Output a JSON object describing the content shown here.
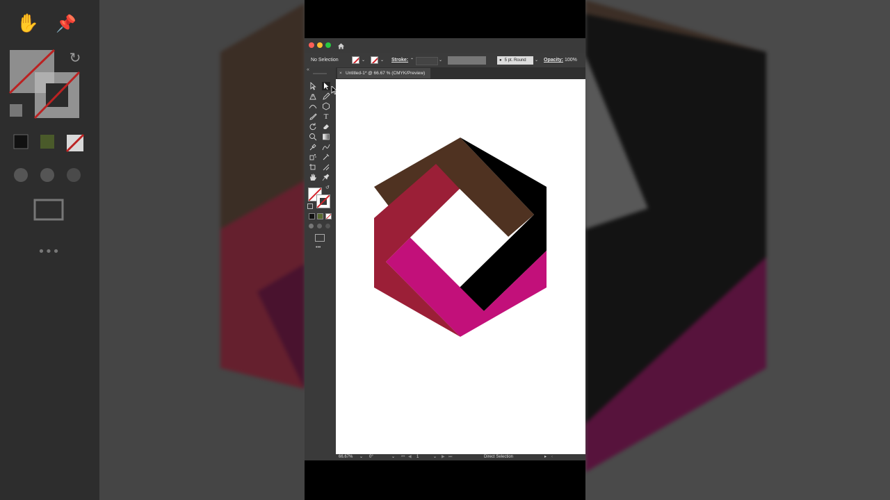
{
  "window": {
    "document_tab": "Untitled-1* @ 66.67 % (CMYK/Preview)",
    "tab_close": "×"
  },
  "control_bar": {
    "selection_label": "No Selection",
    "stroke_label": "Stroke:",
    "stroke_value": "",
    "brush_label": "5 pt. Round",
    "opacity_label": "Opacity:",
    "opacity_value": "100%"
  },
  "status_bar": {
    "zoom": "66.67%",
    "rotation": "0°",
    "artboard": "1",
    "current_tool": "Direct Selection"
  },
  "toolbar": {
    "more_tools": "•••",
    "collapse": "«"
  },
  "artwork": {
    "colors": {
      "brown": "#4f3221",
      "crimson": "#9b1f37",
      "magenta": "#c2107a",
      "black": "#000000",
      "hole": "#ffffff"
    }
  },
  "colors": {
    "ui_dark": "#3a3a3a",
    "canvas": "#ffffff",
    "accent_red": "#d2232a"
  }
}
